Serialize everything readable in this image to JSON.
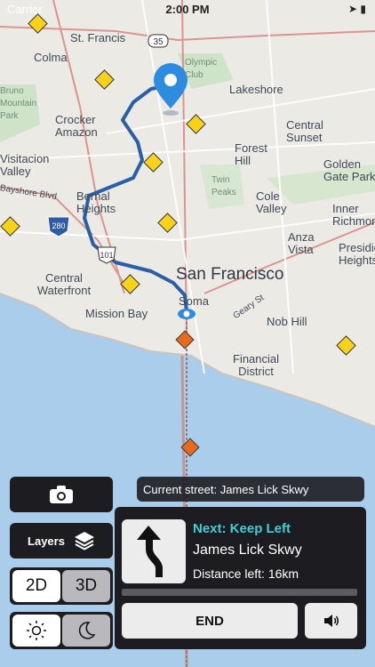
{
  "status": {
    "carrier": "Carrier",
    "time": "2:00 PM",
    "right": "➤ ▮"
  },
  "map": {
    "highway_shields": [
      "35",
      "280",
      "101"
    ],
    "labels": {
      "st_francis": "St. Francis",
      "colma": "Colma",
      "olympic_club": "Olympic Club",
      "lakeshore": "Lakeshore",
      "bruno_mountain": "Bruno Mountain Park",
      "crocker_amazon": "Crocker Amazon",
      "central_sunset": "Central Sunset",
      "forest_hill": "Forest Hill",
      "golden_gate_park": "Golden Gate Park",
      "visitacion_valley": "Visitacion Valley",
      "twin_peaks": "Twin Peaks",
      "bayshore_blvd": "Bayshore Blvd",
      "bernal_heights": "Bernal Heights",
      "cole_valley": "Cole Valley",
      "inner_richmond": "Inner Richmond",
      "anza_vista": "Anza Vista",
      "presidio_heights": "Presidio Heights",
      "san_francisco": "San Francisco",
      "central_waterfront": "Central Waterfront",
      "soma": "Soma",
      "geary_st": "Geary St",
      "mission_bay": "Mission Bay",
      "nob_hill": "Nob Hill",
      "financial_district": "Financial District"
    }
  },
  "controls": {
    "camera_icon": "camera-icon",
    "layers_label": "Layers",
    "mode_2d": "2D",
    "mode_3d": "3D",
    "selected_mode": "2D",
    "day_icon": "sun-icon",
    "night_icon": "moon-icon",
    "selected_theme": "day"
  },
  "current_street": "Current street: James Lick Skwy",
  "navigation": {
    "next_label": "Next: Keep Left",
    "street": "James Lick Skwy",
    "distance": "Distance left: 16km",
    "end_label": "END",
    "sound_icon": "speaker-icon",
    "turn_icon": "keep-left-arrow-icon",
    "accent_color": "#3fd0d6"
  }
}
